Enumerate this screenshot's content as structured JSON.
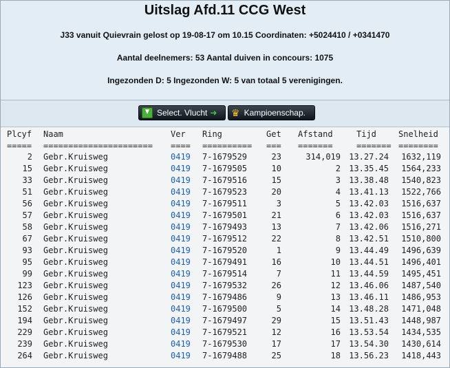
{
  "header": {
    "title": "Uitslag Afd.11 CCG West",
    "line1": "J33 vanuit Quievrain gelost op 19-08-17 om 10.15 Coordinaten: +5024410 / +0341470",
    "line2": "Aantal deelnemers: 53 Aantal duiven in concours: 1075",
    "line3": "Ingezonden D: 5 Ingezonden W: 5 van totaal 5 verenigingen."
  },
  "buttons": {
    "select_label": "Select. Vlucht",
    "kampioen_label": "Kampioenschap."
  },
  "table": {
    "columns": [
      "Plcyf",
      "Naam",
      "Ver",
      "Ring",
      "Get",
      "Afstand",
      "Tijd",
      "Snelheid"
    ],
    "separators": [
      "=====",
      "======================",
      "====",
      "==========",
      "===",
      "=======",
      "=======",
      "========"
    ],
    "rows": [
      [
        "2",
        "Gebr.Kruisweg",
        "0419",
        "7-1679529",
        "23",
        "314,019",
        "13.27.24",
        "1632,119"
      ],
      [
        "15",
        "Gebr.Kruisweg",
        "0419",
        "7-1679505",
        "10",
        "2",
        "13.35.45",
        "1564,233"
      ],
      [
        "33",
        "Gebr.Kruisweg",
        "0419",
        "7-1679516",
        "15",
        "3",
        "13.38.48",
        "1540,823"
      ],
      [
        "51",
        "Gebr.Kruisweg",
        "0419",
        "7-1679523",
        "20",
        "4",
        "13.41.13",
        "1522,766"
      ],
      [
        "56",
        "Gebr.Kruisweg",
        "0419",
        "7-1679511",
        "3",
        "5",
        "13.42.03",
        "1516,637"
      ],
      [
        "57",
        "Gebr.Kruisweg",
        "0419",
        "7-1679501",
        "21",
        "6",
        "13.42.03",
        "1516,637"
      ],
      [
        "58",
        "Gebr.Kruisweg",
        "0419",
        "7-1679493",
        "13",
        "7",
        "13.42.06",
        "1516,271"
      ],
      [
        "67",
        "Gebr.Kruisweg",
        "0419",
        "7-1679512",
        "22",
        "8",
        "13.42.51",
        "1510,800"
      ],
      [
        "93",
        "Gebr.Kruisweg",
        "0419",
        "7-1679520",
        "1",
        "9",
        "13.44.49",
        "1496,639"
      ],
      [
        "95",
        "Gebr.Kruisweg",
        "0419",
        "7-1679491",
        "16",
        "10",
        "13.44.51",
        "1496,401"
      ],
      [
        "99",
        "Gebr.Kruisweg",
        "0419",
        "7-1679514",
        "7",
        "11",
        "13.44.59",
        "1495,451"
      ],
      [
        "123",
        "Gebr.Kruisweg",
        "0419",
        "7-1679532",
        "26",
        "12",
        "13.46.06",
        "1487,540"
      ],
      [
        "126",
        "Gebr.Kruisweg",
        "0419",
        "7-1679486",
        "9",
        "13",
        "13.46.11",
        "1486,953"
      ],
      [
        "152",
        "Gebr.Kruisweg",
        "0419",
        "7-1679500",
        "5",
        "14",
        "13.48.28",
        "1471,048"
      ],
      [
        "194",
        "Gebr.Kruisweg",
        "0419",
        "7-1679497",
        "29",
        "15",
        "13.51.43",
        "1448,987"
      ],
      [
        "229",
        "Gebr.Kruisweg",
        "0419",
        "7-1679521",
        "12",
        "16",
        "13.53.54",
        "1434,535"
      ],
      [
        "239",
        "Gebr.Kruisweg",
        "0419",
        "7-1679530",
        "17",
        "17",
        "13.54.30",
        "1430,614"
      ],
      [
        "264",
        "Gebr.Kruisweg",
        "0419",
        "7-1679488",
        "25",
        "18",
        "13.56.23",
        "1418,443"
      ]
    ]
  },
  "colors": {
    "header_bg": "#e3edf6",
    "link": "#1a5fb4",
    "button_bg": "#1b232b"
  },
  "icons": {
    "select": "download-icon",
    "arrow": "arrow-right-icon",
    "kampioen": "crown-icon"
  }
}
